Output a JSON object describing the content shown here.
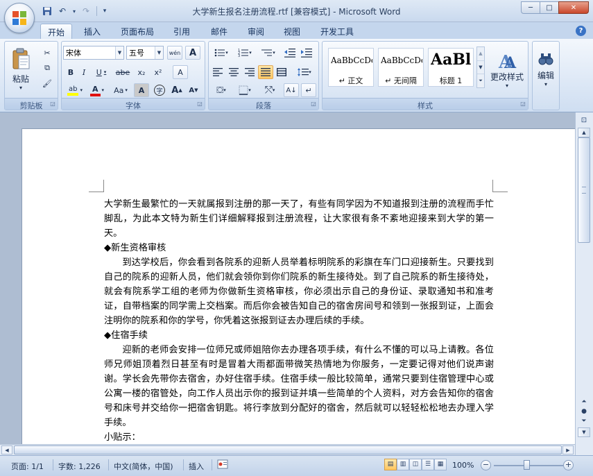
{
  "window": {
    "title": "大学新生报名注册流程.rtf [兼容模式] - Microsoft Word",
    "minimize": "─",
    "maximize": "□",
    "close": "✕"
  },
  "qat": {
    "save": "💾",
    "undo": "↶",
    "redo": "↷",
    "more": "▾"
  },
  "tabs": [
    "开始",
    "插入",
    "页面布局",
    "引用",
    "邮件",
    "审阅",
    "视图",
    "开发工具"
  ],
  "help": "?",
  "ribbon": {
    "clipboard": {
      "label": "剪贴板",
      "paste": "粘贴",
      "cut": "✂",
      "copy": "⧉",
      "brush": "🖌"
    },
    "font": {
      "label": "字体",
      "font_name": "宋体",
      "font_size": "五号",
      "bold": "B",
      "italic": "I",
      "underline": "U",
      "strike": "abe",
      "subscript": "x₂",
      "superscript": "x²",
      "clear": "A",
      "change_case": "Aa",
      "grow": "A",
      "shrink": "A",
      "phonetic": "wén",
      "border_char": "A",
      "shade_char": "A",
      "enclose": "字"
    },
    "paragraph": {
      "label": "段落"
    },
    "styles": {
      "label": "样式",
      "items": [
        {
          "sample": "AaBbCcDc",
          "name": "↵ 正文"
        },
        {
          "sample": "AaBbCcDc",
          "name": "↵ 无间隔"
        },
        {
          "sample": "AaBl",
          "name": "标题 1"
        }
      ],
      "change_styles": "更改样式"
    },
    "editing": {
      "label": "编辑"
    },
    "colors": {
      "accent": "#3973c5",
      "highlight": "#ffc865",
      "font_red": "#e01010",
      "highlight_yellow": "#ffff00"
    }
  },
  "document": {
    "paragraphs": [
      {
        "kind": "p",
        "text": "大学新生最繁忙的一天就属报到注册的那一天了，有些有同学因为不知道报到注册的流程而手忙脚乱，为此本文特为新生们详细解释报到注册流程，让大家很有条不紊地迎接来到大学的第一天。"
      },
      {
        "kind": "hd",
        "text": "◆新生资格审核"
      },
      {
        "kind": "ind",
        "text": "到达学校后，你会看到各院系的迎新人员举着标明院系的彩旗在车门口迎接新生。只要找到自己的院系的迎新人员，他们就会领你到你们院系的新生接待处。到了自己院系的新生接待处，就会有院系学工组的老师为你做新生资格审核，你必须出示自己的身份证、录取通知书和准考证，自带档案的同学需上交档案。而后你会被告知自己的宿舍房间号和领到一张报到证，上面会注明你的院系和你的学号，你凭着这张报到证去办理后续的手续。"
      },
      {
        "kind": "hd",
        "text": "◆住宿手续"
      },
      {
        "kind": "ind",
        "text": "迎新的老师会安排一位师兄或师姐陪你去办理各项手续，有什么不懂的可以马上请教。各位师兄师姐顶着烈日甚至有时是冒着大雨都面带微笑热情地为你服务，一定要记得对他们说声谢谢。学长会先带你去宿舍，办好住宿手续。住宿手续一般比较简单，通常只要到住宿管理中心或公寓一楼的宿管处，向工作人员出示你的报到证并填一些简单的个人资料，对方会告知你的宿舍号和床号并交给你一把宿舍钥匙。将行李放到分配好的宿舍，然后就可以轻轻松松地去办理入学手续。"
      },
      {
        "kind": "hd",
        "text": "小贴示："
      }
    ]
  },
  "statusbar": {
    "page": "页面: 1/1",
    "words": "字数: 1,226",
    "language": "中文(简体，中国)",
    "mode": "插入",
    "zoom": "100%",
    "zoom_out": "−",
    "zoom_in": "+"
  }
}
